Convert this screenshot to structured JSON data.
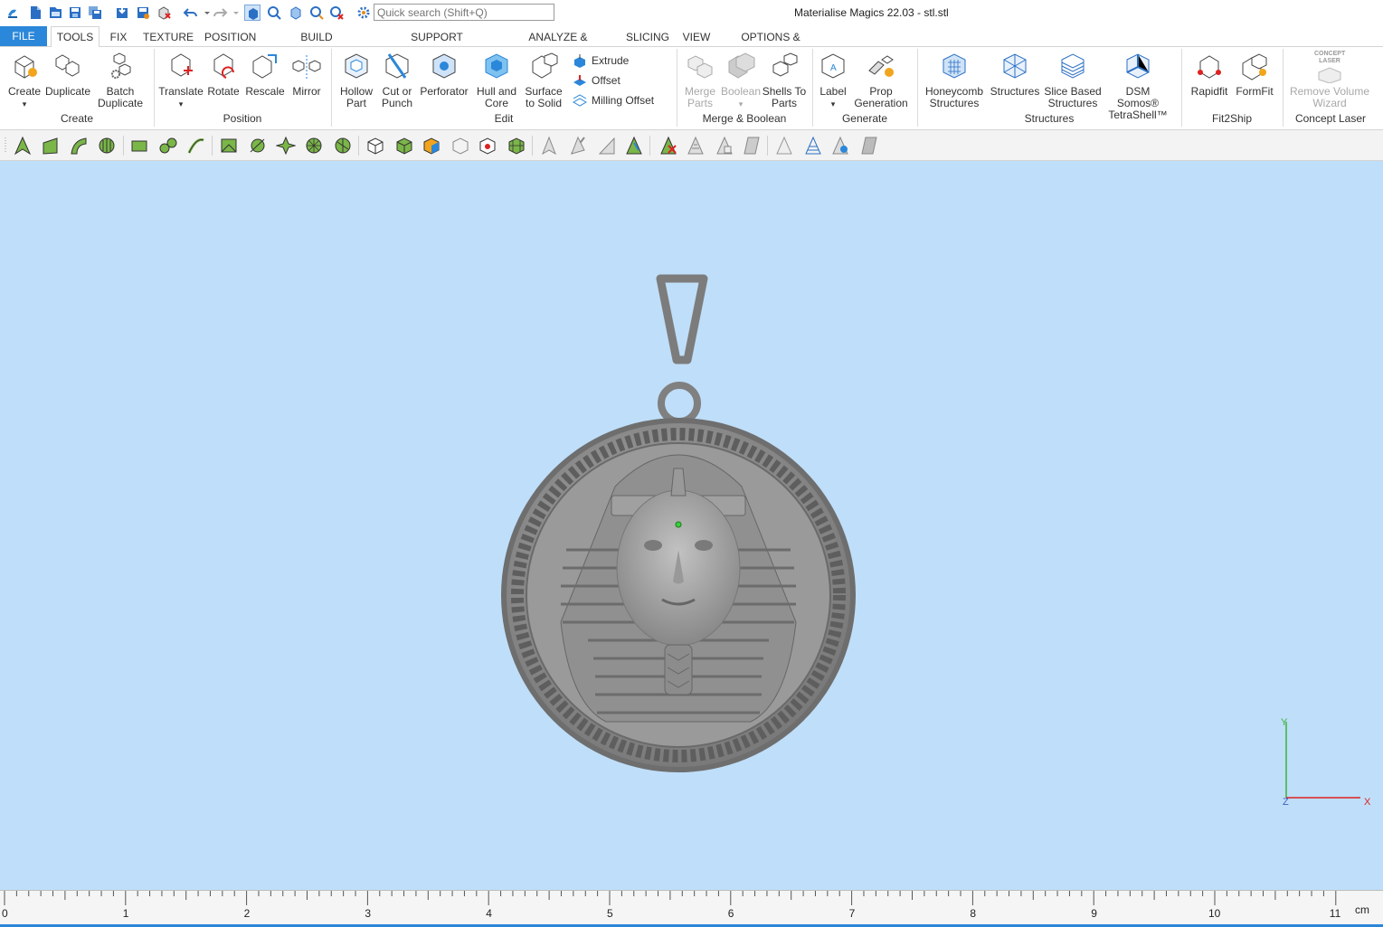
{
  "app": {
    "title": "Materialise Magics 22.03 - stl.stl",
    "search_placeholder": "Quick search (Shift+Q)"
  },
  "tabs": [
    "FILE",
    "TOOLS",
    "FIX",
    "TEXTURE",
    "POSITION",
    "BUILD PREPARATION",
    "SUPPORT GENERATION",
    "ANALYZE & REPORT",
    "SLICING",
    "VIEW",
    "OPTIONS & HELP"
  ],
  "ribbon": {
    "create": {
      "label": "Create",
      "buttons": [
        "Create",
        "Duplicate",
        "Batch Duplicate"
      ]
    },
    "position": {
      "label": "Position",
      "buttons": [
        "Translate",
        "Rotate",
        "Rescale",
        "Mirror"
      ]
    },
    "edit": {
      "label": "Edit",
      "buttons": [
        "Hollow Part",
        "Cut or Punch",
        "Perforator",
        "Hull and Core",
        "Surface to Solid"
      ],
      "small": [
        "Extrude",
        "Offset",
        "Milling Offset"
      ]
    },
    "merge": {
      "label": "Merge & Boolean",
      "buttons": [
        "Merge Parts",
        "Boolean",
        "Shells To Parts"
      ]
    },
    "generate": {
      "label": "Generate",
      "buttons": [
        "Label",
        "Prop Generation"
      ]
    },
    "structures": {
      "label": "Structures",
      "buttons": [
        "Honeycomb Structures",
        "Structures",
        "Slice Based Structures",
        "DSM Somos® TetraShell™"
      ]
    },
    "fit2ship": {
      "label": "Fit2Ship",
      "buttons": [
        "Rapidfit",
        "FormFit"
      ]
    },
    "concept": {
      "label": "Concept Laser",
      "buttons": [
        "Remove Volume Wizard"
      ],
      "logo": "CONCEPT LASER"
    }
  },
  "axes": {
    "y": "Y",
    "z": "Z",
    "x": "X"
  },
  "ruler": {
    "unit": "cm",
    "labels": [
      "0",
      "1",
      "2",
      "3",
      "4",
      "5",
      "6",
      "7",
      "8",
      "9",
      "10",
      "11"
    ]
  },
  "colors": {
    "accent": "#2b87d9",
    "viewport": "#bfdef9",
    "model": "#8a8a8a"
  }
}
